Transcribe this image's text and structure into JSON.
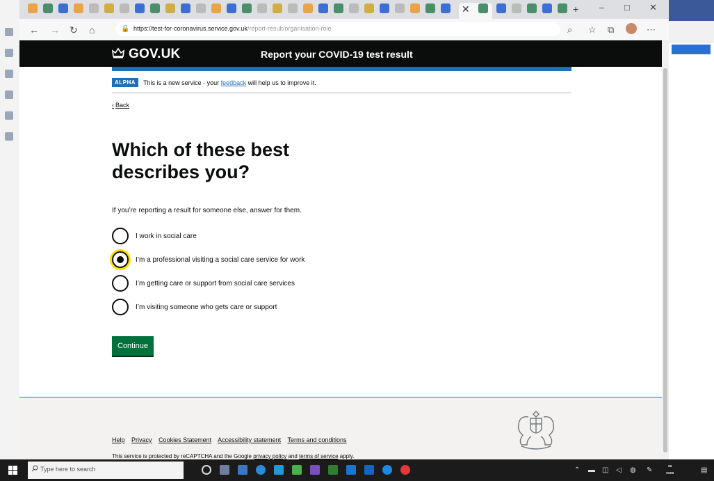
{
  "browser": {
    "url_host": "https://test-for-coronavirus.service.gov.uk",
    "url_path": "/report-result/organisation-role"
  },
  "header": {
    "logo_text": "GOV.UK",
    "service_name": "Report your COVID-19 test result"
  },
  "phase_banner": {
    "tag": "ALPHA",
    "text_before": "This is a new service - your",
    "link": "feedback",
    "text_after": "will help us to improve it."
  },
  "back_link": "Back",
  "question": {
    "title": "Which of these best describes you?",
    "hint": "If you’re reporting a result for someone else, answer for them.",
    "options": [
      {
        "label": "I work in social care",
        "checked": false
      },
      {
        "label": "I’m a professional visiting a social care service for work",
        "checked": true
      },
      {
        "label": "I’m getting care or support from social care services",
        "checked": false
      },
      {
        "label": "I’m visiting someone who gets care or support",
        "checked": false
      }
    ]
  },
  "continue_label": "Continue",
  "footer": {
    "links": [
      "Help",
      "Privacy",
      "Cookies Statement",
      "Accessibility statement",
      "Terms and conditions"
    ],
    "recaptcha_before": "This service is protected by reCAPTCHA and the Google",
    "privacy_policy": "privacy policy",
    "and": "and",
    "terms_of_service": "terms of service",
    "recaptcha_after": "apply."
  },
  "taskbar": {
    "search_placeholder": "Type here to search"
  },
  "colors": {
    "govuk_black": "#0b0c0c",
    "govuk_blue": "#1d70b8",
    "button_green": "#00703c",
    "focus_yellow": "#ffdd00",
    "footer_grey": "#f3f2f1"
  }
}
